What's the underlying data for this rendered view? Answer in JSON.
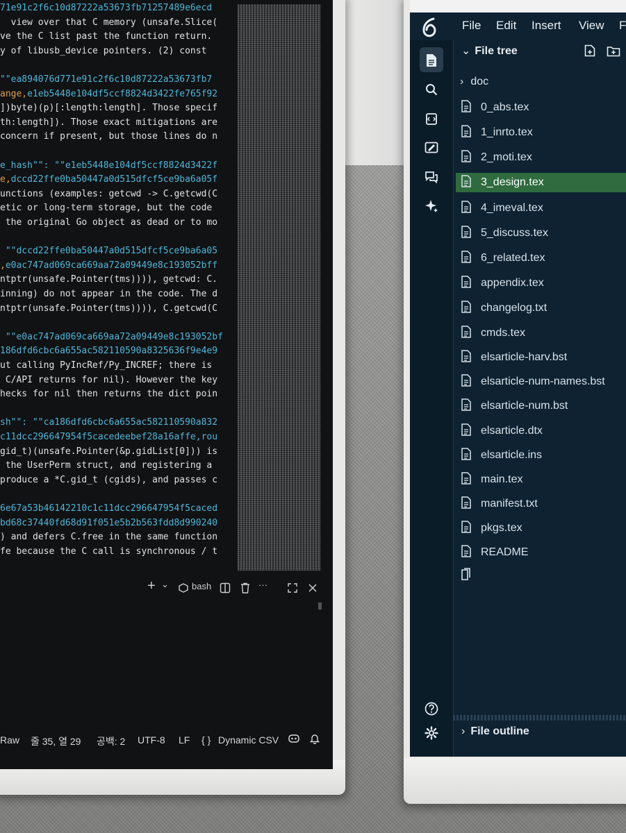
{
  "code_lines": [
    {
      "plain": "71e91c2f6c10d87222a53673fb71257489e6ecd",
      "str": "",
      "rest": "",
      "hash": true
    },
    {
      "plain": "  view over that C memory (unsafe.Slice(",
      "str": "",
      "rest": ""
    },
    {
      "plain": "ve the C list past the function return.",
      "str": "",
      "rest": ""
    },
    {
      "plain": "y of libusb_device pointers. (2) const",
      "str": "",
      "rest": ""
    },
    {
      "plain": "",
      "str": "",
      "rest": ""
    },
    {
      "plain": "",
      "str": "\"\"ea894076d771e91c2f6c10d87222a53673fb7",
      "rest": ""
    },
    {
      "plain": "",
      "str": "ange,",
      "rest": "e1eb5448e104df5ccf8824d3422fe765f92",
      "hashrest": true
    },
    {
      "plain": "])byte)(p)[:length:length]. Those specif",
      "str": "",
      "rest": ""
    },
    {
      "plain": "th:length]). Those exact mitigations are",
      "str": "",
      "rest": ""
    },
    {
      "plain": "concern if present, but those lines do n",
      "str": "",
      "rest": ""
    },
    {
      "plain": "",
      "str": "",
      "rest": ""
    },
    {
      "plain": "",
      "str": "e_hash\"\": \"\"e1eb5448e104df5ccf8824d3422f",
      "rest": ""
    },
    {
      "plain": "",
      "str": "e,",
      "rest": "dccd22ffe0ba50447a0d515dfcf5ce9ba6a05f",
      "hashrest": true
    },
    {
      "plain": "unctions (examples: getcwd -> C.getcwd(C",
      "str": "",
      "rest": ""
    },
    {
      "plain": "etic or long-term storage, but the code",
      "str": "",
      "rest": ""
    },
    {
      "plain": " the original Go object as dead or to mo",
      "str": "",
      "rest": ""
    },
    {
      "plain": "",
      "str": "",
      "rest": ""
    },
    {
      "plain": "",
      "str": " \"\"dccd22ffe0ba50447a0d515dfcf5ce9ba6a05",
      "rest": ""
    },
    {
      "plain": "",
      "str": ",",
      "rest": "e0ac747ad069ca669aa72a09449e8c193052bff",
      "hashrest": true
    },
    {
      "plain": "ntptr(unsafe.Pointer(tms)))), getcwd: C.",
      "str": "",
      "rest": ""
    },
    {
      "plain": "inning) do not appear in the code. The d",
      "str": "",
      "rest": ""
    },
    {
      "plain": "ntptr(unsafe.Pointer(tms)))), C.getcwd(C",
      "str": "",
      "rest": ""
    },
    {
      "plain": "",
      "str": "",
      "rest": ""
    },
    {
      "plain": "",
      "str": " \"\"e0ac747ad069ca669aa72a09449e8c193052bf",
      "rest": ""
    },
    {
      "plain": "",
      "str": "186dfd6cbc6a655ac582110590a8325636f9e4e9",
      "rest": ""
    },
    {
      "plain": "ut calling PyIncRef/Py_INCREF; there is",
      "str": "",
      "rest": ""
    },
    {
      "plain": " C/API returns for nil). However the key",
      "str": "",
      "rest": ""
    },
    {
      "plain": "hecks for nil then returns the dict poin",
      "str": "",
      "rest": ""
    },
    {
      "plain": "",
      "str": "",
      "rest": ""
    },
    {
      "plain": "",
      "str": "sh\"\": \"\"ca186dfd6cbc6a655ac582110590a832",
      "rest": ""
    },
    {
      "plain": "",
      "str": "c11dcc296647954f5cacedeebef28a16affe,rou",
      "rest": "",
      "hash": true
    },
    {
      "plain": "gid_t)(unsafe.Pointer(&p.gidList[0])) is",
      "str": "",
      "rest": ""
    },
    {
      "plain": " the UserPerm struct, and registering a",
      "str": "",
      "rest": ""
    },
    {
      "plain": "produce a *C.gid_t (cgids), and passes c",
      "str": "",
      "rest": ""
    },
    {
      "plain": "",
      "str": "",
      "rest": ""
    },
    {
      "plain": "",
      "str": "6e67a53b46142210c1c11dcc296647954f5caced",
      "rest": ""
    },
    {
      "plain": "",
      "str": "bd68c37440fd68d91f051e5b2b563fdd8d990240",
      "rest": "",
      "hash": true
    },
    {
      "plain": ") and defers C.free in the same function",
      "str": "",
      "rest": ""
    },
    {
      "plain": "fe because the C call is synchronous / t",
      "str": "",
      "rest": ""
    }
  ],
  "terminal": {
    "plus_label": "+",
    "chevron": "⌄",
    "shell_label": "bash",
    "more_label": "···"
  },
  "status_bar": {
    "raw": "Raw",
    "position": "줄 35, 열 29",
    "spaces": "공백: 2",
    "encoding": "UTF-8",
    "eol": "LF",
    "language": "Dynamic CSV"
  },
  "menu": {
    "items": [
      "File",
      "Edit",
      "Insert",
      "View",
      "F"
    ]
  },
  "file_tree": {
    "title": "File tree",
    "folder": "doc",
    "files": [
      "0_abs.tex",
      "1_inrto.tex",
      "2_moti.tex",
      "3_design.tex",
      "4_imeval.tex",
      "5_discuss.tex",
      "6_related.tex",
      "appendix.tex",
      "changelog.txt",
      "cmds.tex",
      "elsarticle-harv.bst",
      "elsarticle-num-names.bst",
      "elsarticle-num.bst",
      "elsarticle.dtx",
      "elsarticle.ins",
      "main.tex",
      "manifest.txt",
      "pkgs.tex",
      "README"
    ],
    "selected": "3_design.tex"
  },
  "file_outline": {
    "title": "File outline"
  },
  "colors": {
    "selected_row": "#2f6b3f",
    "string_blue": "#4fb6d8",
    "hash_orange": "#dfa04a",
    "overleaf_bg": "#0e2231"
  }
}
